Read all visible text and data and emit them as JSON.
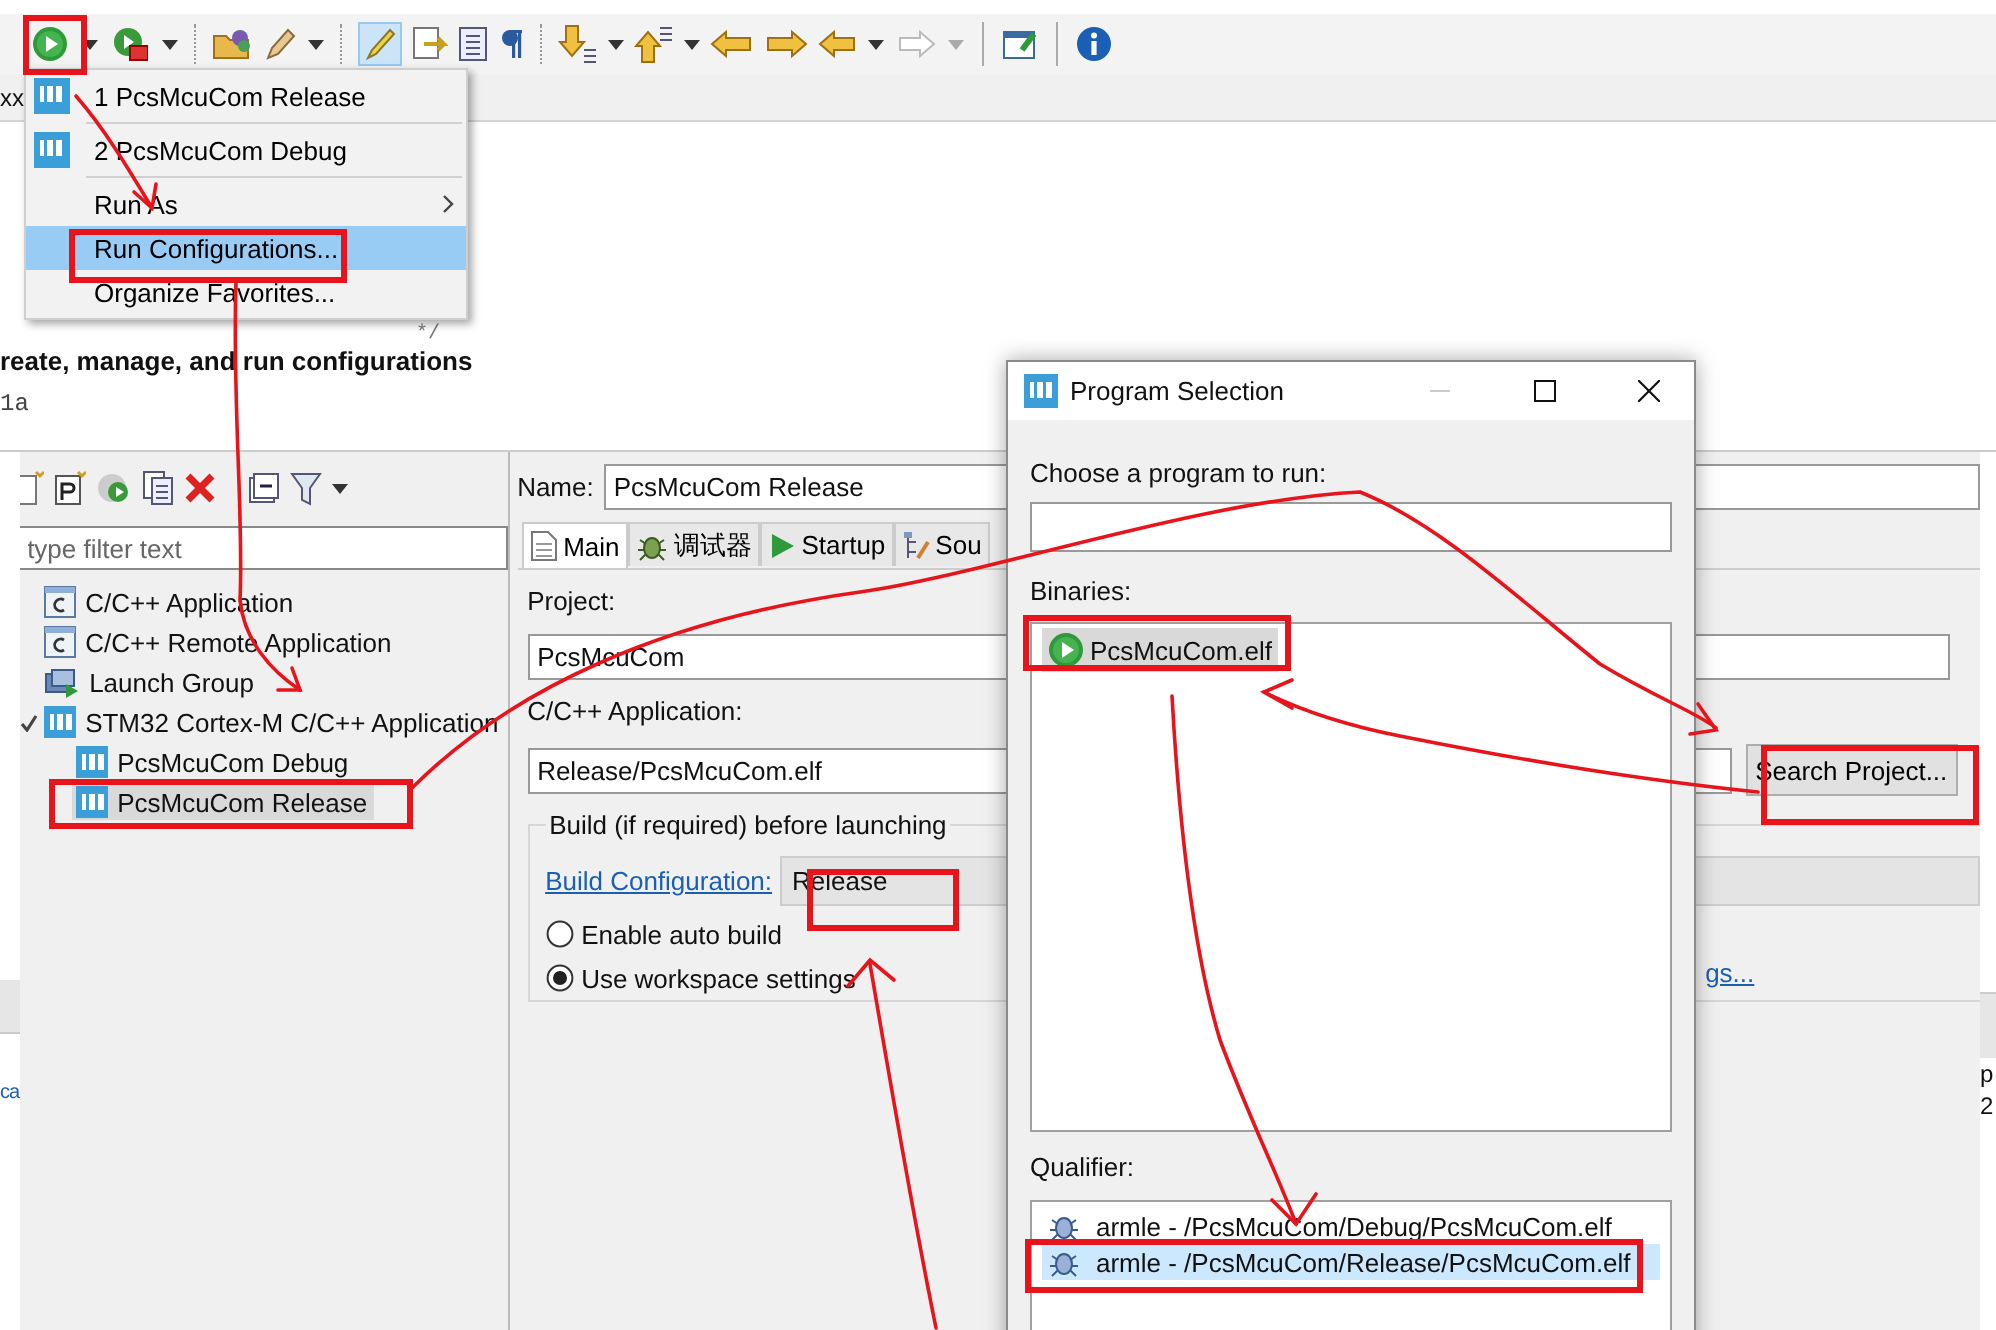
{
  "toolbar": {
    "highlight_toggle": {
      "pressed": true
    },
    "forward_button": {
      "disabled": true
    }
  },
  "editor_tab_strip": {
    "fragment": "xx"
  },
  "editor_fragments": {
    "comment_end": "*/",
    "line_start": "1a"
  },
  "run_menu": {
    "items": [
      {
        "kind": "launch",
        "label": "1 PcsMcuCom Release",
        "selected": false
      },
      {
        "kind": "launch",
        "label": "2 PcsMcuCom Debug",
        "selected": false
      },
      {
        "kind": "submenu",
        "label": "Run As",
        "selected": false
      },
      {
        "kind": "action",
        "label": "Run Configurations...",
        "selected": true
      },
      {
        "kind": "action",
        "label": "Organize Favorites...",
        "selected": false
      }
    ]
  },
  "run_configurations": {
    "heading": "reate, manage, and run configurations",
    "filter": {
      "placeholder": "type filter text"
    },
    "tree": [
      {
        "kind": "c",
        "label": "C/C++ Application",
        "selected": false
      },
      {
        "kind": "c",
        "label": "C/C++ Remote Application",
        "selected": false
      },
      {
        "kind": "group",
        "label": "Launch Group",
        "selected": false
      },
      {
        "kind": "ide",
        "label": "STM32 Cortex-M C/C++ Application",
        "selected": false,
        "expanded": true,
        "children": [
          {
            "kind": "ide",
            "label": "PcsMcuCom Debug",
            "selected": false
          },
          {
            "kind": "ide",
            "label": "PcsMcuCom Release",
            "selected": true
          }
        ]
      }
    ],
    "name": {
      "label": "Name:",
      "value": "PcsMcuCom Release"
    },
    "tabs": [
      {
        "kind": "main",
        "label": "Main",
        "selected": true
      },
      {
        "kind": "debugger",
        "label": "调试器",
        "selected": false
      },
      {
        "kind": "startup",
        "label": "Startup",
        "selected": false
      },
      {
        "kind": "source",
        "label": "Sou",
        "selected": false
      }
    ],
    "project": {
      "label": "Project:",
      "value": "PcsMcuCom"
    },
    "application": {
      "label": "C/C++ Application:",
      "value": "Release/PcsMcuCom.elf"
    },
    "search_button": "Search Project...",
    "build_group": {
      "title": "Build (if required) before launching",
      "link": "Build Configuration:",
      "combo": "Release",
      "options": [
        {
          "label": "Enable auto build",
          "selected": false
        },
        {
          "label": "Use workspace settings",
          "selected": true
        }
      ],
      "settings_link": "gs..."
    },
    "left_edge_fragment": "ca",
    "right_edge_fragments": [
      "p",
      "2"
    ]
  },
  "program_selection": {
    "title": "Program Selection",
    "minimize_disabled": true,
    "prompt": "Choose a program to run:",
    "binaries_label": "Binaries:",
    "binaries": [
      {
        "label": "PcsMcuCom.elf",
        "selected": true
      }
    ],
    "qualifier_label": "Qualifier:",
    "qualifiers": [
      {
        "label": "armle - /PcsMcuCom/Debug/PcsMcuCom.elf",
        "selected": false
      },
      {
        "label": "armle - /PcsMcuCom/Release/PcsMcuCom.elf",
        "selected": true
      }
    ]
  }
}
